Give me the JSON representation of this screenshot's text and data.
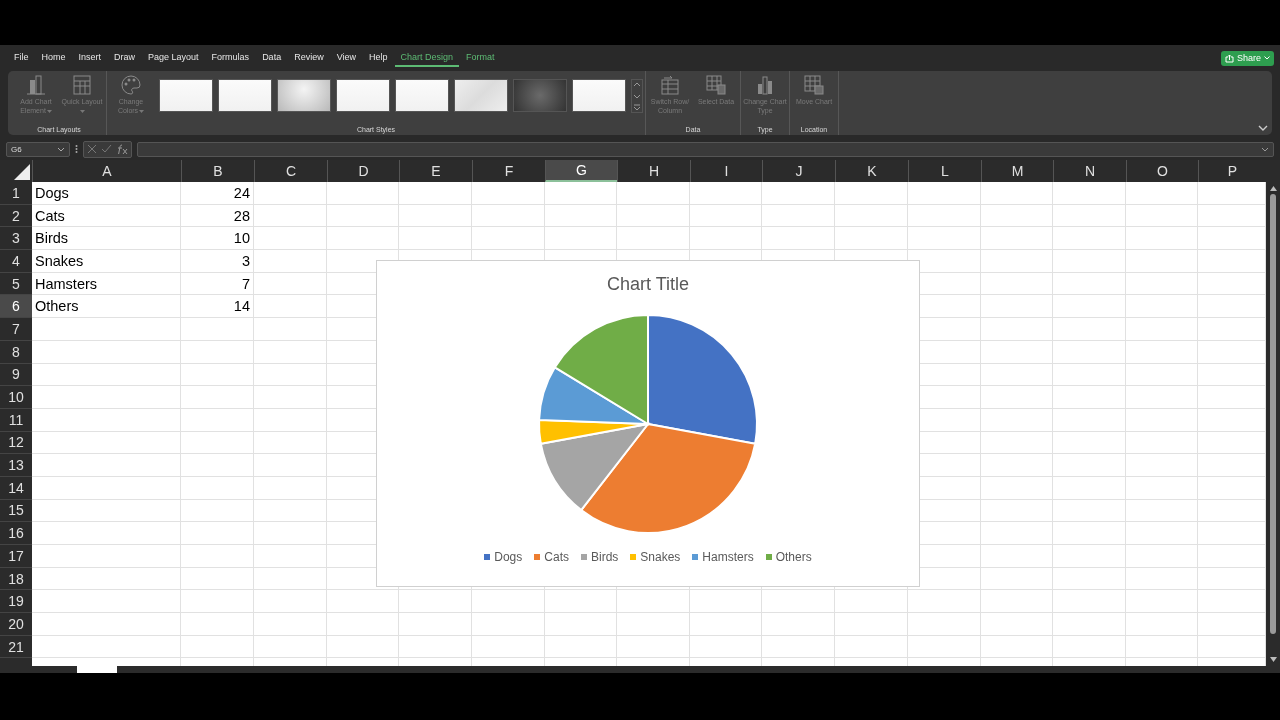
{
  "menu_tabs": [
    {
      "label": "File",
      "kind": "standard",
      "selected": false
    },
    {
      "label": "Home",
      "kind": "standard",
      "selected": false
    },
    {
      "label": "Insert",
      "kind": "standard",
      "selected": false
    },
    {
      "label": "Draw",
      "kind": "standard",
      "selected": false
    },
    {
      "label": "Page Layout",
      "kind": "standard",
      "selected": false
    },
    {
      "label": "Formulas",
      "kind": "standard",
      "selected": false
    },
    {
      "label": "Data",
      "kind": "standard",
      "selected": false
    },
    {
      "label": "Review",
      "kind": "standard",
      "selected": false
    },
    {
      "label": "View",
      "kind": "standard",
      "selected": false
    },
    {
      "label": "Help",
      "kind": "standard",
      "selected": false
    },
    {
      "label": "Chart Design",
      "kind": "contextual",
      "selected": true
    },
    {
      "label": "Format",
      "kind": "contextual",
      "selected": false
    }
  ],
  "share_button": {
    "label": "Share"
  },
  "ribbon_groups": [
    {
      "label": "Chart Layouts",
      "buttons": [
        {
          "label": "Add Chart Element",
          "disabled": true,
          "has_menu": true
        },
        {
          "label": "Quick Layout",
          "disabled": true,
          "has_menu": true
        }
      ]
    },
    {
      "label": "Chart Styles",
      "buttons": [
        {
          "label": "Change Colors",
          "disabled": true,
          "has_menu": true
        }
      ],
      "gallery": [
        {
          "kind": "plain"
        },
        {
          "kind": "plain"
        },
        {
          "kind": "gradient"
        },
        {
          "kind": "plain"
        },
        {
          "kind": "plain"
        },
        {
          "kind": "textured"
        },
        {
          "kind": "dark"
        },
        {
          "kind": "plain"
        }
      ]
    },
    {
      "label": "Data",
      "buttons": [
        {
          "label": "Switch Row/ Column",
          "disabled": true,
          "has_menu": false
        },
        {
          "label": "Select Data",
          "disabled": true,
          "has_menu": false
        }
      ]
    },
    {
      "label": "Type",
      "buttons": [
        {
          "label": "Change Chart Type",
          "disabled": true,
          "has_menu": false
        }
      ]
    },
    {
      "label": "Location",
      "buttons": [
        {
          "label": "Move Chart",
          "disabled": true,
          "has_menu": false
        }
      ]
    }
  ],
  "name_box": {
    "value": "G6"
  },
  "columns": [
    {
      "label": "A",
      "selected": false
    },
    {
      "label": "B",
      "selected": false
    },
    {
      "label": "C",
      "selected": false
    },
    {
      "label": "D",
      "selected": false
    },
    {
      "label": "E",
      "selected": false
    },
    {
      "label": "F",
      "selected": false
    },
    {
      "label": "G",
      "selected": true
    },
    {
      "label": "H",
      "selected": false
    },
    {
      "label": "I",
      "selected": false
    },
    {
      "label": "J",
      "selected": false
    },
    {
      "label": "K",
      "selected": false
    },
    {
      "label": "L",
      "selected": false
    },
    {
      "label": "M",
      "selected": false
    },
    {
      "label": "N",
      "selected": false
    },
    {
      "label": "O",
      "selected": false
    },
    {
      "label": "P",
      "selected": false
    }
  ],
  "rows": [
    {
      "label": "1",
      "selected": false,
      "cells": [
        "Dogs",
        "24"
      ]
    },
    {
      "label": "2",
      "selected": false,
      "cells": [
        "Cats",
        "28"
      ]
    },
    {
      "label": "3",
      "selected": false,
      "cells": [
        "Birds",
        "10"
      ]
    },
    {
      "label": "4",
      "selected": false,
      "cells": [
        "Snakes",
        "3"
      ]
    },
    {
      "label": "5",
      "selected": false,
      "cells": [
        "Hamsters",
        "7"
      ]
    },
    {
      "label": "6",
      "selected": true,
      "cells": [
        "Others",
        "14"
      ]
    },
    {
      "label": "7",
      "selected": false,
      "cells": []
    },
    {
      "label": "8",
      "selected": false,
      "cells": []
    },
    {
      "label": "9",
      "selected": false,
      "cells": []
    },
    {
      "label": "10",
      "selected": false,
      "cells": []
    },
    {
      "label": "11",
      "selected": false,
      "cells": []
    },
    {
      "label": "12",
      "selected": false,
      "cells": []
    },
    {
      "label": "13",
      "selected": false,
      "cells": []
    },
    {
      "label": "14",
      "selected": false,
      "cells": []
    },
    {
      "label": "15",
      "selected": false,
      "cells": []
    },
    {
      "label": "16",
      "selected": false,
      "cells": []
    },
    {
      "label": "17",
      "selected": false,
      "cells": []
    },
    {
      "label": "18",
      "selected": false,
      "cells": []
    },
    {
      "label": "19",
      "selected": false,
      "cells": []
    },
    {
      "label": "20",
      "selected": false,
      "cells": []
    },
    {
      "label": "21",
      "selected": false,
      "cells": []
    }
  ],
  "chart": {
    "chart_data": {
      "type": "pie",
      "title": "Chart Title",
      "categories": [
        "Dogs",
        "Cats",
        "Birds",
        "Snakes",
        "Hamsters",
        "Others"
      ],
      "series": [
        {
          "colors": [
            "#4472c4",
            "#ed7d31",
            "#a5a5a5",
            "#ffc000",
            "#5b9bd5",
            "#70ad47"
          ],
          "values": [
            27.9,
            32.6,
            11.6,
            3.5,
            8.1,
            16.3
          ]
        }
      ]
    }
  }
}
